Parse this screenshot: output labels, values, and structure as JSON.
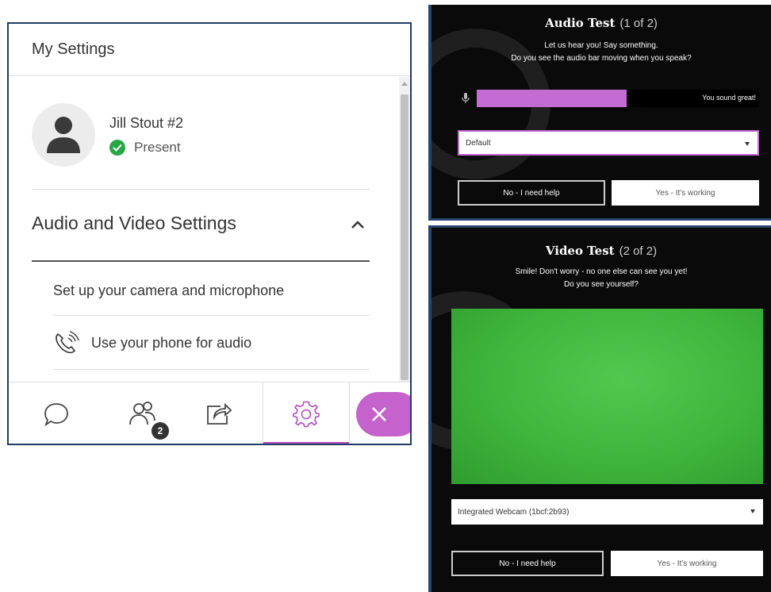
{
  "settings": {
    "title": "My Settings",
    "user": {
      "name": "Jill Stout #2",
      "status": "Present",
      "status_color": "#27a744"
    },
    "av_section": {
      "heading": "Audio and Video Settings",
      "items": [
        {
          "label": "Set up your camera and microphone"
        },
        {
          "label": "Use your phone for audio",
          "icon": "phone-icon"
        }
      ]
    },
    "bottom_tabs": [
      {
        "name": "chat",
        "icon": "chat-bubble-icon"
      },
      {
        "name": "participants",
        "icon": "participants-icon",
        "badge": "2"
      },
      {
        "name": "share",
        "icon": "share-icon"
      },
      {
        "name": "settings",
        "icon": "gear-icon",
        "active": true
      }
    ],
    "close_button": {
      "icon": "close-icon",
      "color": "#c562cc"
    },
    "accent_color": "#b34dbd"
  },
  "audio_test": {
    "title": "Audio Test",
    "step": "(1 of 2)",
    "line1": "Let us hear you! Say something.",
    "line2": "Do you see the audio bar moving when you speak?",
    "level": 0.53,
    "meter_color": "#c56bd4",
    "meter_text": "You sound great!",
    "device": "Default",
    "no_button": "No - I need help",
    "yes_button": "Yes - It's working"
  },
  "video_test": {
    "title": "Video Test",
    "step": "(2 of 2)",
    "line1": "Smile! Don't worry - no one else can see you yet!",
    "line2": "Do you see yourself?",
    "device": "Integrated Webcam (1bcf:2b93)",
    "no_button": "No - I need help",
    "yes_button": "Yes - It's working"
  }
}
